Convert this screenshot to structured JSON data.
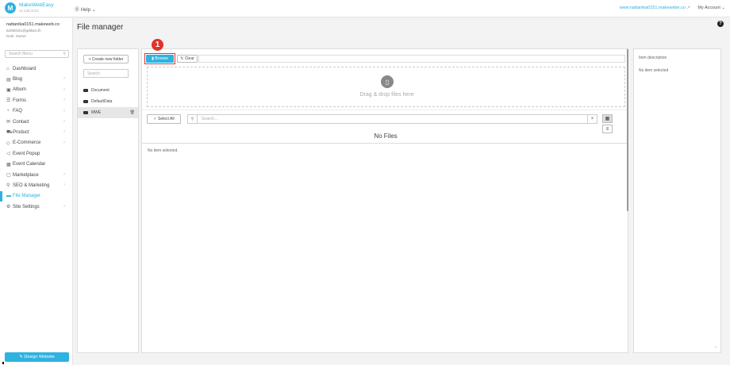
{
  "brand": {
    "name": "MakeWebEasy",
    "version": "v4.149.1013",
    "accent": "#2fb2e0"
  },
  "topbar": {
    "help_label": "Help",
    "site_link": "www.nattanika0151.makewebe.co",
    "account_label": "My Account"
  },
  "user": {
    "email": "nattanika0151.makeweb.co",
    "id": "62080151@gdikasi.th",
    "role": "Role: Owner"
  },
  "sidebar": {
    "search_placeholder": "Search Menu",
    "items": [
      {
        "label": "Dashboard",
        "icon": "home-icon",
        "has_children": false,
        "active": false
      },
      {
        "label": "Blog",
        "icon": "blog-icon",
        "has_children": true,
        "active": false
      },
      {
        "label": "Album",
        "icon": "album-icon",
        "has_children": true,
        "active": false
      },
      {
        "label": "Forms",
        "icon": "forms-icon",
        "has_children": true,
        "active": false
      },
      {
        "label": "FAQ",
        "icon": "faq-icon",
        "has_children": true,
        "active": false
      },
      {
        "label": "Contact",
        "icon": "contact-icon",
        "has_children": true,
        "active": false
      },
      {
        "label": "Product",
        "icon": "cart-icon",
        "has_children": true,
        "active": false
      },
      {
        "label": "E-Commerce",
        "icon": "tag-icon",
        "has_children": true,
        "active": false
      },
      {
        "label": "Event Popup",
        "icon": "megaphone-icon",
        "has_children": false,
        "active": false
      },
      {
        "label": "Event Calendar",
        "icon": "calendar-icon",
        "has_children": false,
        "active": false
      },
      {
        "label": "Marketplace",
        "icon": "bag-icon",
        "has_children": true,
        "active": false
      },
      {
        "label": "SEO & Marketing",
        "icon": "search-icon",
        "has_children": true,
        "active": false
      },
      {
        "label": "File Manager",
        "icon": "folder-icon",
        "has_children": false,
        "active": true
      },
      {
        "label": "Site Settings",
        "icon": "gear-icon",
        "has_children": true,
        "active": false
      }
    ],
    "design_button": "Design Website"
  },
  "page": {
    "title": "File manager",
    "help_icon": "?"
  },
  "folders": {
    "create_label": "Create new folder",
    "search_placeholder": "Search",
    "items": [
      {
        "name": "Document",
        "selected": false
      },
      {
        "name": "DefaultData",
        "selected": false
      },
      {
        "name": "MWE",
        "selected": true
      }
    ]
  },
  "files": {
    "step_number": "1",
    "browse_label": "Browse",
    "clear_label": "Clear",
    "dropzone_text": "Drag & drop files here",
    "select_all_label": "Select All",
    "search_placeholder": "Search...",
    "empty_title": "No Files",
    "selection_status": "No item selected."
  },
  "description": {
    "title": "Item description",
    "empty_text": "No item selected"
  }
}
